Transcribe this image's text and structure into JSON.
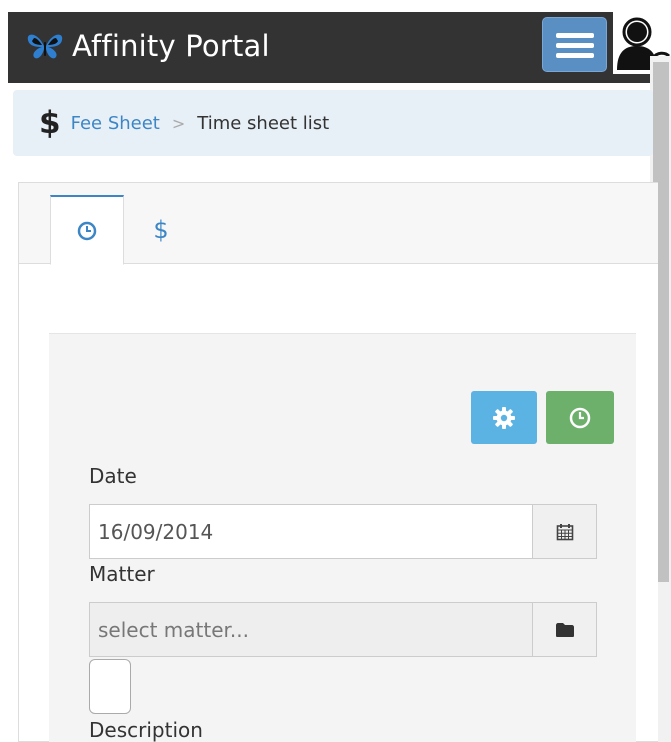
{
  "app": {
    "title": "Affinity Portal"
  },
  "breadcrumb": {
    "link": "Fee Sheet",
    "separator": ">",
    "current": "Time sheet list"
  },
  "form": {
    "date_label": "Date",
    "date_value": "16/09/2014",
    "matter_label": "Matter",
    "matter_placeholder": "select matter...",
    "description_label": "Description"
  },
  "tabs": [
    {
      "icon": "clock-icon",
      "active": true
    },
    {
      "icon": "dollar-icon",
      "active": false
    }
  ],
  "colors": {
    "navbar": "#333333",
    "accent": "#3d86c6",
    "menu_button": "#5a8fc4",
    "settings_button": "#5bb3e3",
    "clock_button": "#6cb06c",
    "breadcrumb_bg": "#e7eff7"
  }
}
